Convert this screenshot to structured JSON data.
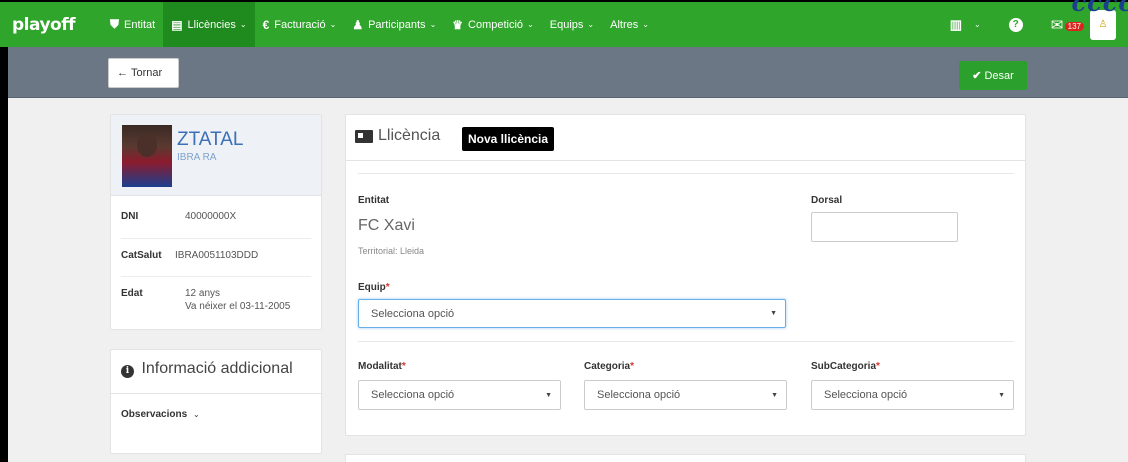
{
  "nav": {
    "logo": "playoff",
    "items": [
      {
        "icon": "shield-icon",
        "glyph": "⛊",
        "label": "Entitat",
        "chevron": false,
        "active": false
      },
      {
        "icon": "id-card-icon",
        "glyph": "▤",
        "label": "Llicències",
        "chevron": true,
        "active": true
      },
      {
        "icon": "euro-icon",
        "glyph": "€",
        "label": "Facturació",
        "chevron": true,
        "active": false
      },
      {
        "icon": "user-icon",
        "glyph": "♟",
        "label": "Participants",
        "chevron": true,
        "active": false
      },
      {
        "icon": "trophy-icon",
        "glyph": "♛",
        "label": "Competició",
        "chevron": true,
        "active": false
      },
      {
        "icon": "",
        "glyph": "",
        "label": "Equips",
        "chevron": true,
        "active": false
      },
      {
        "icon": "",
        "glyph": "",
        "label": "Altres",
        "chevron": true,
        "active": false
      }
    ],
    "mail_badge": "137",
    "brand_text": "cccc"
  },
  "actions": {
    "back_label": "Tornar",
    "save_label": "Desar"
  },
  "profile": {
    "name": "ZTATAL",
    "subname": "IBRA RA",
    "dni_label": "DNI",
    "dni_value": "40000000X",
    "catsalut_label": "CatSalut",
    "catsalut_value": "IBRA0051103DDD",
    "edat_label": "Edat",
    "edat_value": "12 anys",
    "birth_text": "Va néixer el 03-11-2005"
  },
  "info": {
    "title": "Informació addicional",
    "observacions": "Observacions"
  },
  "licence": {
    "title": "Llicència",
    "badge": "Nova llicència",
    "entitat_label": "Entitat",
    "entitat_value": "FC Xavi",
    "territorial": "Territorial: Lleida",
    "dorsal_label": "Dorsal",
    "equip_label": "Equip",
    "modalitat_label": "Modalitat",
    "categoria_label": "Categoria",
    "subcategoria_label": "SubCategoria",
    "select_placeholder": "Selecciona opció",
    "required_mark": "*"
  },
  "colors": {
    "nav_green": "#2fa52b",
    "action_grey": "#6b7785",
    "link_blue": "#3b6fb6",
    "required_red": "#d9342b"
  }
}
